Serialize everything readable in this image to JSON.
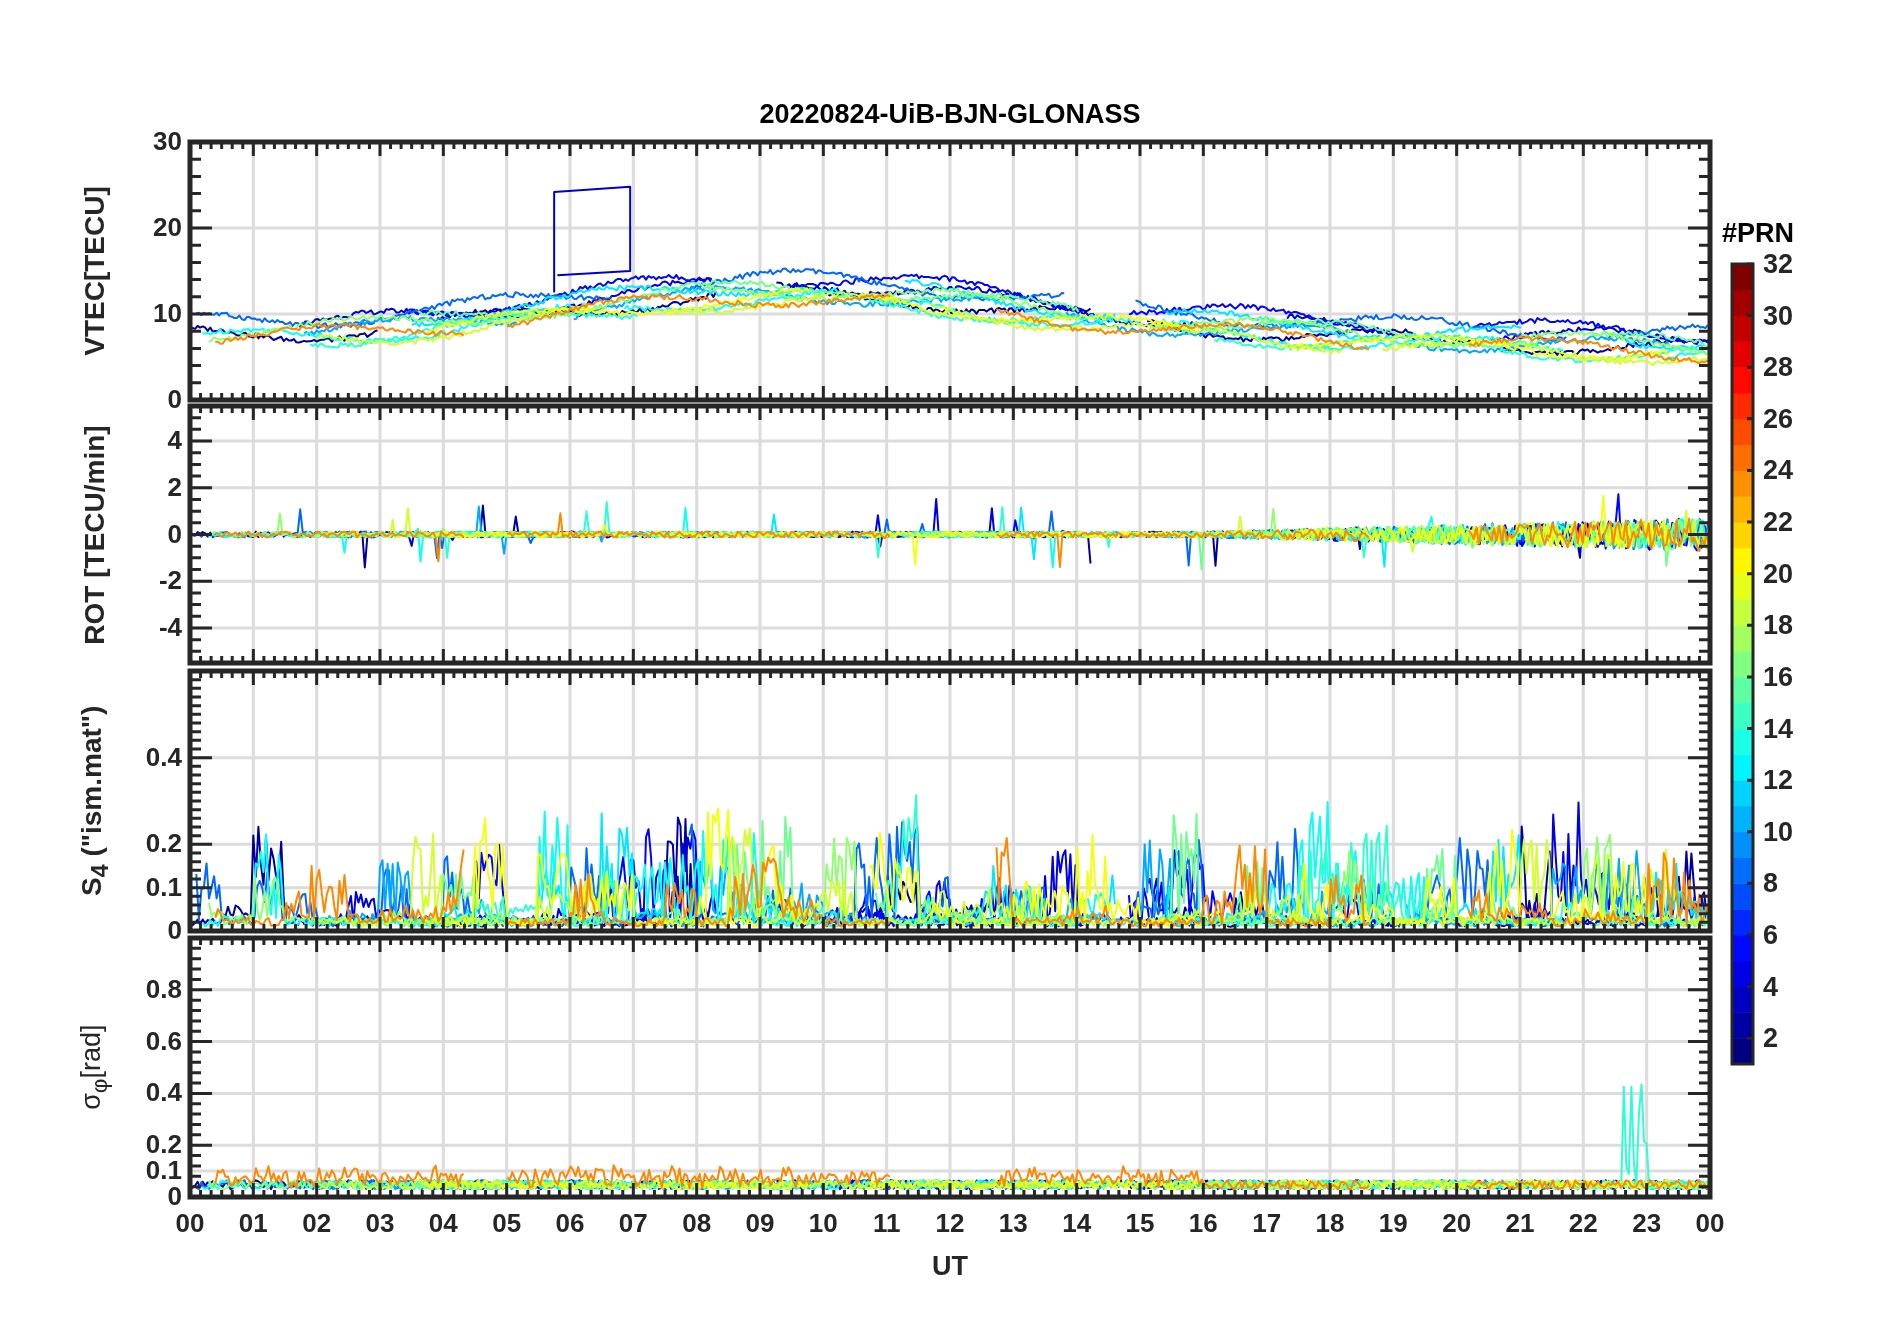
{
  "title": "20220824-UiB-BJN-GLONASS",
  "panels": [
    {
      "kind": "vtec",
      "ylabel": "VTEC[TECU]",
      "yticks": [
        "30",
        "20",
        "10",
        "0"
      ]
    },
    {
      "kind": "rot",
      "ylabel": "ROT [TECU/min]",
      "yticks": [
        "4",
        "2",
        "0",
        "-2",
        "-4"
      ]
    },
    {
      "kind": "s4",
      "ylabel": "S$_{4}$ (\"ism.mat\")",
      "yticks": [
        "0.4",
        "0.2",
        "0.1",
        "0"
      ]
    },
    {
      "kind": "sigma",
      "ylabel": "σ$_{φ}$[rad]",
      "yticks": [
        "0.8",
        "0.6",
        "0.4",
        "0.2",
        "0.1",
        "0"
      ]
    }
  ],
  "xaxis": {
    "label": "UT",
    "ticks": [
      "00",
      "01",
      "02",
      "03",
      "04",
      "05",
      "06",
      "07",
      "08",
      "09",
      "10",
      "11",
      "12",
      "13",
      "14",
      "15",
      "16",
      "17",
      "18",
      "19",
      "20",
      "21",
      "22",
      "23",
      "00"
    ]
  },
  "colorbar": {
    "label": "#PRN",
    "ticks": [
      "32",
      "30",
      "28",
      "26",
      "24",
      "22",
      "20",
      "18",
      "16",
      "14",
      "12",
      "10",
      "8",
      "6",
      "4",
      "2"
    ]
  }
}
